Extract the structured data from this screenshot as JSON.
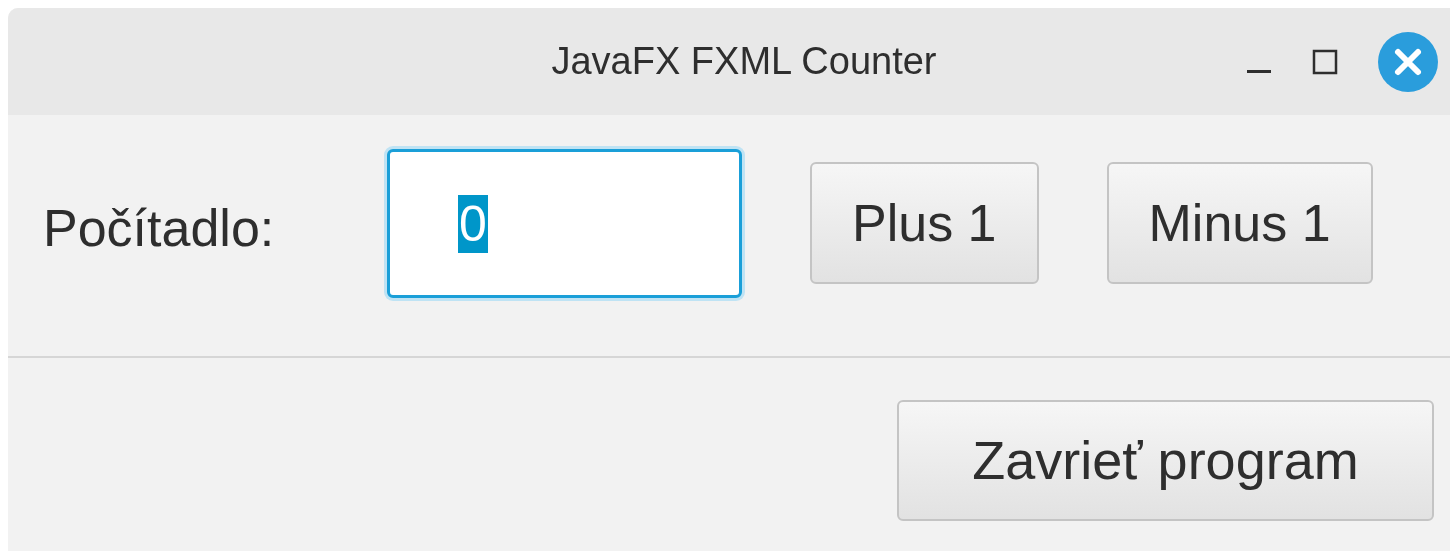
{
  "window": {
    "title": "JavaFX FXML Counter"
  },
  "counter": {
    "label": "Počítadlo:",
    "field": {
      "value": "0",
      "focused": true,
      "text_selected": true
    }
  },
  "buttons": [
    "Plus 1",
    "Minus 1"
  ],
  "footer": {
    "button": "Zavrieť program"
  }
}
